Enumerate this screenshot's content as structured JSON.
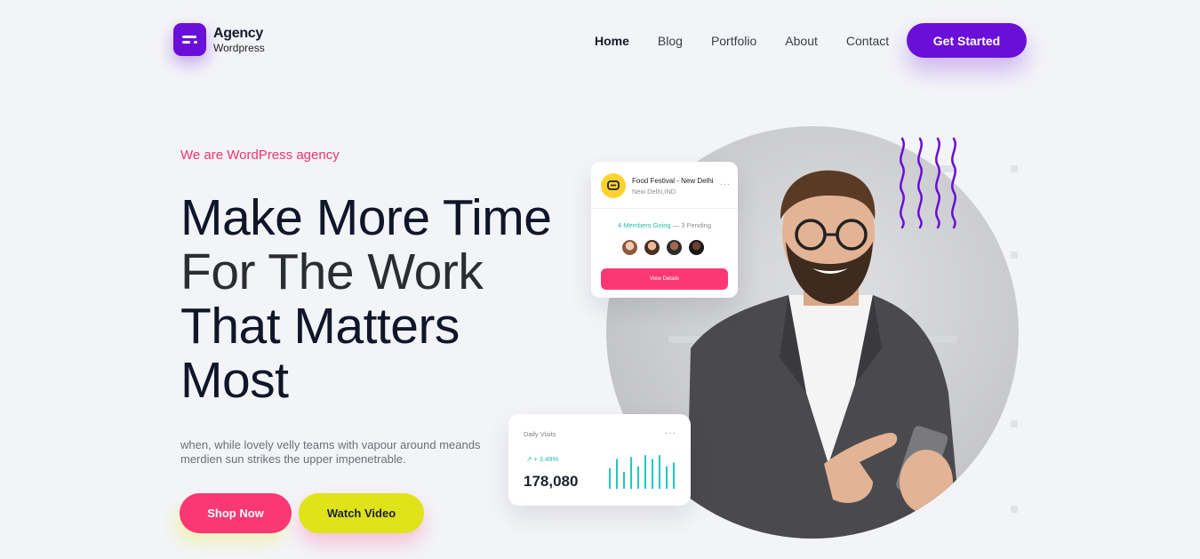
{
  "brand": {
    "title": "Agency",
    "subtitle": "Wordpress",
    "accent": "#6a0fd8"
  },
  "nav": {
    "items": [
      {
        "label": "Home",
        "active": true
      },
      {
        "label": "Blog"
      },
      {
        "label": "Portfolio"
      },
      {
        "label": "About"
      },
      {
        "label": "Contact"
      }
    ],
    "cta_label": "Get Started"
  },
  "hero": {
    "eyebrow": "We are WordPress agency",
    "headline": [
      "Make More Time",
      "For The Work",
      "That Matters",
      "Most"
    ],
    "description": "when, while lovely velly teams with vapour around meands merdien sun strikes the upper impenetrable.",
    "primary_button": "Shop Now",
    "secondary_button": "Watch Video",
    "primary_color": "#fb3873",
    "secondary_color": "#dfe31a"
  },
  "event_card": {
    "title": "Food Festival - New Delhi",
    "location": "New Delhi,IND",
    "members_going": "4 Members Going",
    "separator": "—",
    "pending": "3 Pending",
    "button_label": "View Details"
  },
  "visits_card": {
    "title": "Daily Visits",
    "change": "+ 3.49%",
    "value": "178,080",
    "bars": [
      0.55,
      0.8,
      0.45,
      0.85,
      0.6,
      0.9,
      0.8,
      0.9,
      0.6,
      0.7
    ]
  }
}
